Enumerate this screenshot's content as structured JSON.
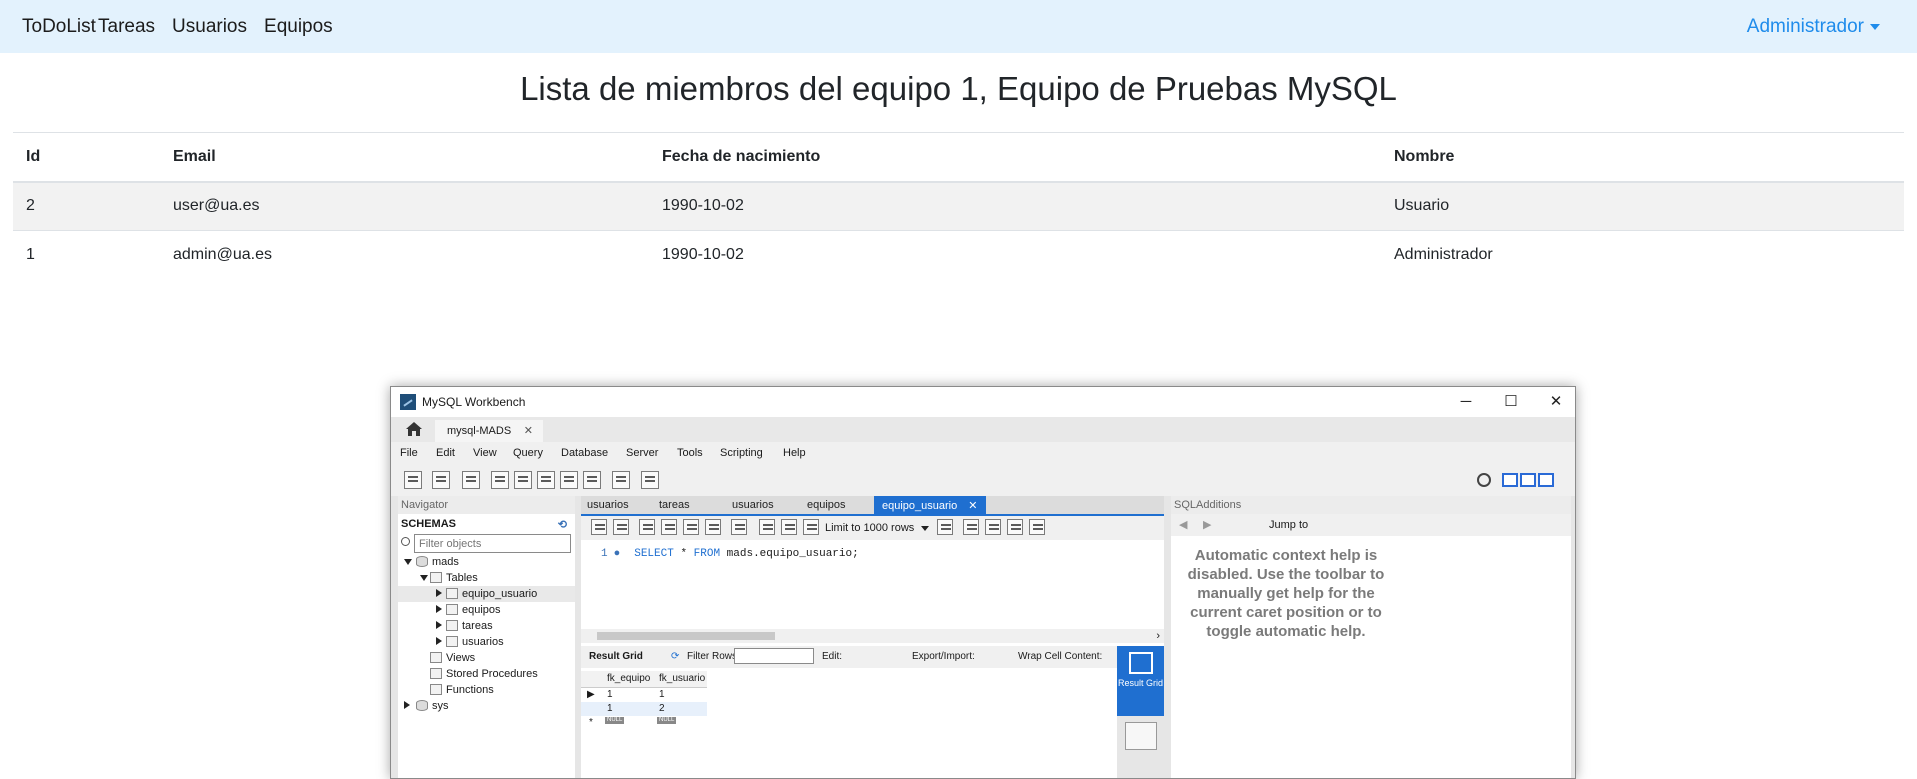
{
  "navbar": {
    "brand": "ToDoList",
    "links": [
      "Tareas",
      "Usuarios",
      "Equipos"
    ],
    "user": "Administrador"
  },
  "page_title": "Lista de miembros del equipo 1, Equipo de Pruebas MySQL",
  "members_table": {
    "headers": [
      "Id",
      "Email",
      "Fecha de nacimiento",
      "Nombre"
    ],
    "rows": [
      [
        "2",
        "user@ua.es",
        "1990-10-02",
        "Usuario"
      ],
      [
        "1",
        "admin@ua.es",
        "1990-10-02",
        "Administrador"
      ]
    ]
  },
  "workbench": {
    "title": "MySQL Workbench",
    "window_controls": [
      "─",
      "☐",
      "✕"
    ],
    "connection_tab": "mysql-MADS",
    "menu": [
      "File",
      "Edit",
      "View",
      "Query",
      "Database",
      "Server",
      "Tools",
      "Scripting",
      "Help"
    ],
    "navigator": {
      "header": "Navigator",
      "schemas_label": "SCHEMAS",
      "filter_placeholder": "Filter objects",
      "tree": [
        {
          "label": "mads"
        },
        {
          "label": "Tables"
        },
        {
          "label": "equipo_usuario"
        },
        {
          "label": "equipos"
        },
        {
          "label": "tareas"
        },
        {
          "label": "usuarios"
        },
        {
          "label": "Views"
        },
        {
          "label": "Stored Procedures"
        },
        {
          "label": "Functions"
        },
        {
          "label": "sys"
        }
      ]
    },
    "editor": {
      "tabs": [
        "usuarios",
        "tareas",
        "usuarios",
        "equipos",
        "equipo_usuario"
      ],
      "limit": "Limit to 1000 rows",
      "line_number": "1",
      "query_keyword1": "SELECT",
      "query_star": "*",
      "query_keyword2": "FROM",
      "query_table": "mads.equipo_usuario;"
    },
    "result": {
      "result_grid_label": "Result Grid",
      "filter_rows_label": "Filter Rows:",
      "edit_label": "Edit:",
      "export_label": "Export/Import:",
      "wrap_label": "Wrap Cell Content:",
      "columns": [
        "fk_equipo",
        "fk_usuario"
      ],
      "rows": [
        [
          "1",
          "1"
        ],
        [
          "1",
          "2"
        ]
      ],
      "null_tag": "NULL",
      "side_button": "Result Grid"
    },
    "sql_additions": {
      "header": "SQLAdditions",
      "jump_to": "Jump to",
      "help_text": "Automatic context help is disabled. Use the toolbar to manually get help for the current caret position or to toggle automatic help."
    }
  }
}
